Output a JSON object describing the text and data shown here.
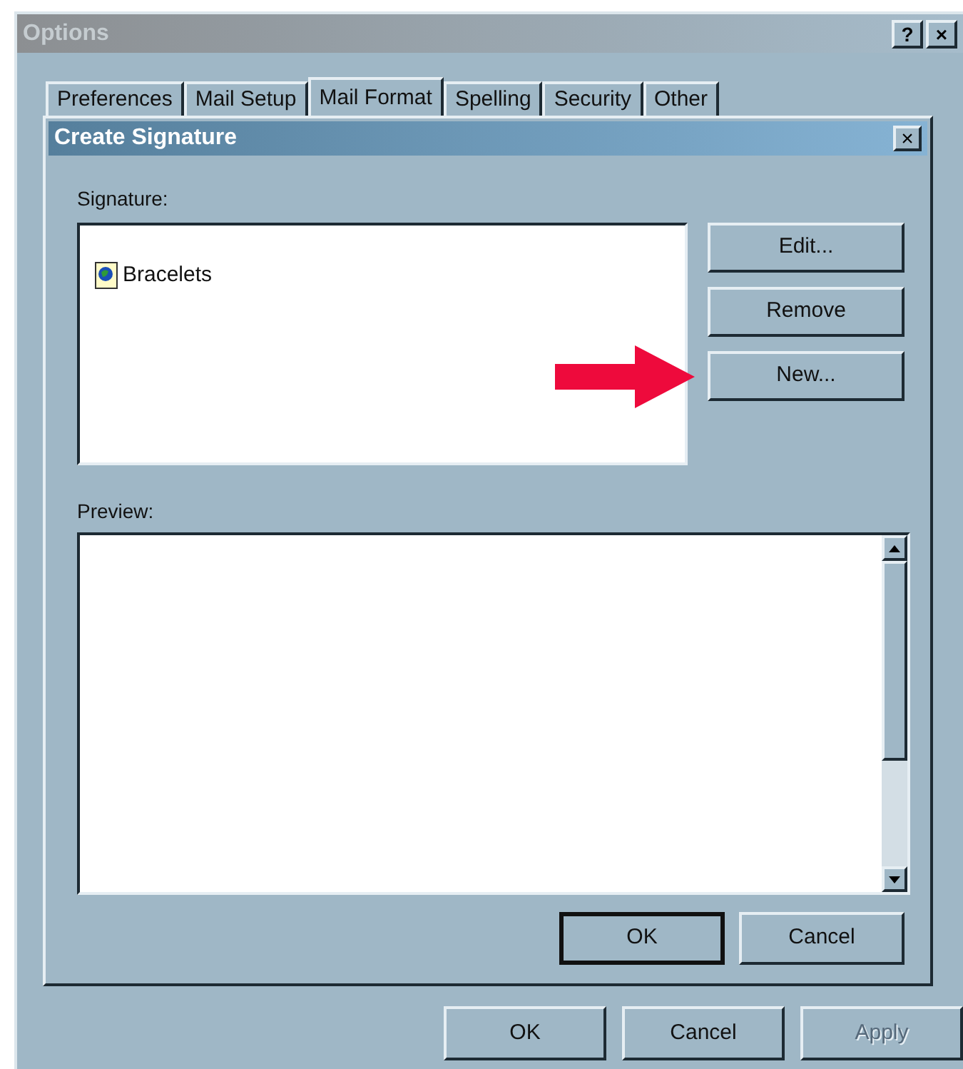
{
  "window": {
    "title": "Options",
    "active": false,
    "title_buttons": [
      "?",
      "×"
    ]
  },
  "tabs": [
    {
      "label": "Preferences",
      "selected": false
    },
    {
      "label": "Mail Setup",
      "selected": false
    },
    {
      "label": "Mail Format",
      "selected": true
    },
    {
      "label": "Spelling",
      "selected": false
    },
    {
      "label": "Security",
      "selected": false
    },
    {
      "label": "Other",
      "selected": false
    }
  ],
  "dialog": {
    "title": "Create Signature",
    "close": "×",
    "signature_label": "Signature:",
    "signatures": [
      {
        "name": "Bracelets",
        "selected": false
      }
    ],
    "side_buttons": [
      "Edit...",
      "Remove",
      "New..."
    ],
    "preview_label": "Preview:",
    "buttons": [
      {
        "label": "OK",
        "default": true
      },
      {
        "label": "Cancel",
        "default": false
      }
    ]
  },
  "buttons": [
    {
      "label": "OK",
      "disabled": false
    },
    {
      "label": "Cancel",
      "disabled": false
    },
    {
      "label": "Apply",
      "disabled": true
    }
  ]
}
